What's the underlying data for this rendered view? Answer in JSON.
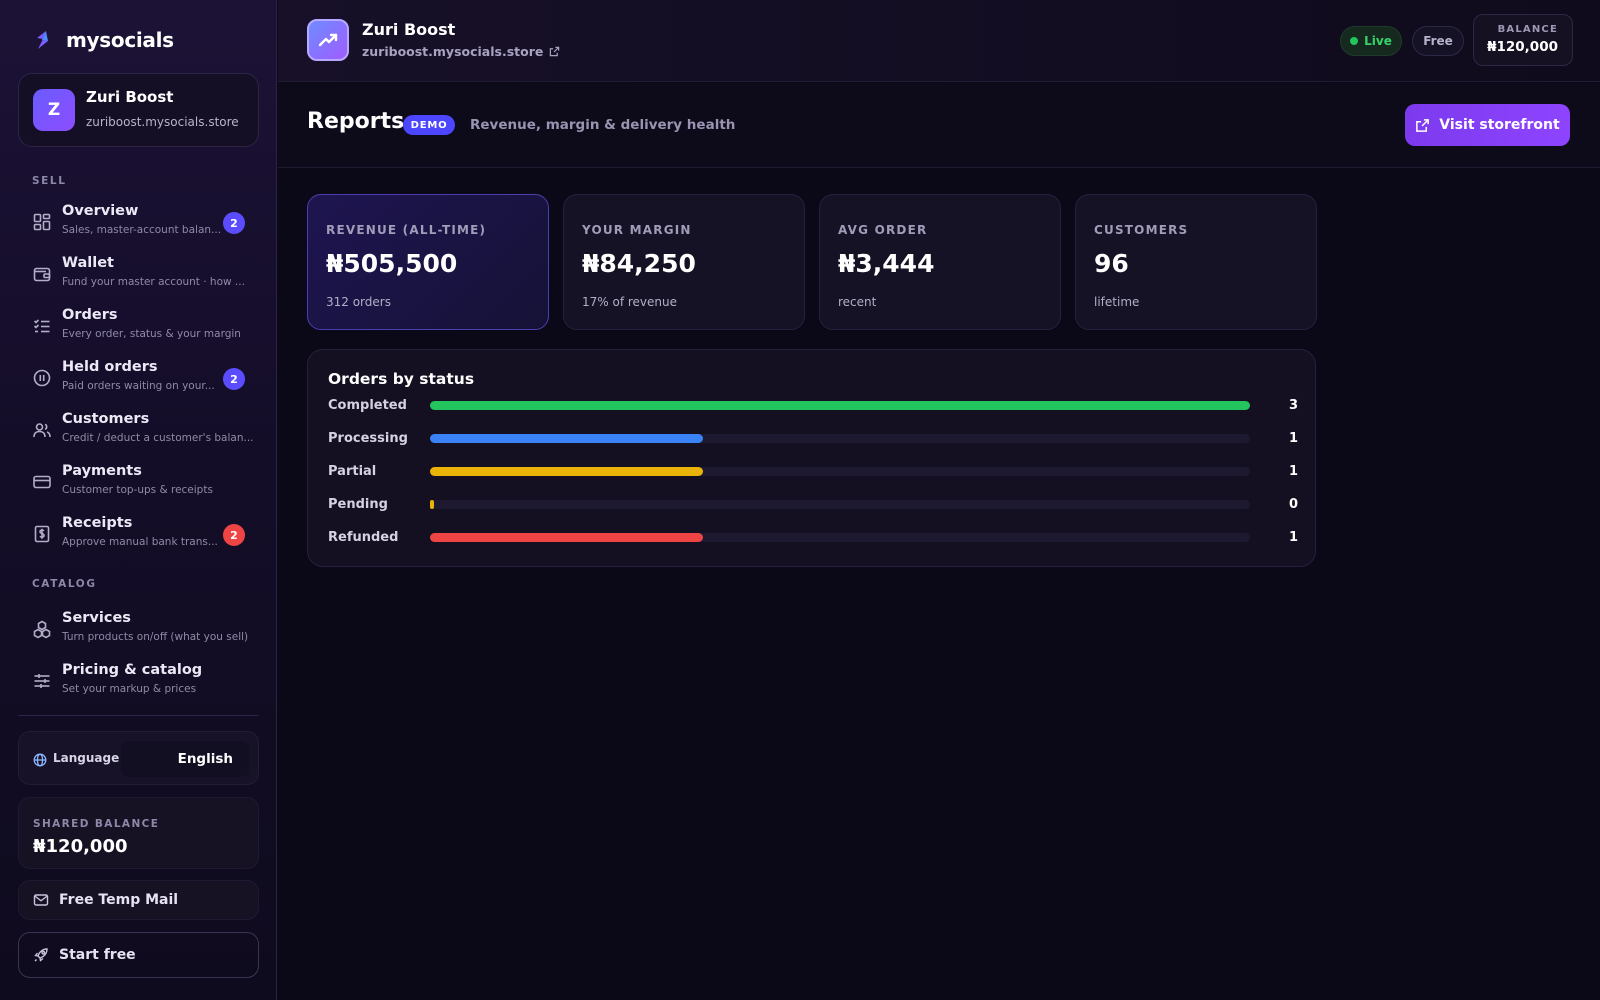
{
  "sidebar": {
    "brand": "mysocials",
    "store": {
      "initial": "Z",
      "name": "Zuri Boost",
      "url": "zuriboost.mysocials.store"
    },
    "sections": {
      "sell": "SELL",
      "catalog": "CATALOG"
    },
    "items": [
      {
        "title": "Overview",
        "subtitle": "Sales, master-account balan...",
        "icon": "grid-icon",
        "badge": "2",
        "badge_color": "#5b4dff"
      },
      {
        "title": "Wallet",
        "subtitle": "Fund your master account · how ...",
        "icon": "wallet-icon"
      },
      {
        "title": "Orders",
        "subtitle": "Every order, status & your margin",
        "icon": "checklist-icon"
      },
      {
        "title": "Held orders",
        "subtitle": "Paid orders waiting on your...",
        "icon": "pause-circle-icon",
        "badge": "2",
        "badge_color": "#5b4dff"
      },
      {
        "title": "Customers",
        "subtitle": "Credit / deduct a customer's balan...",
        "icon": "users-icon"
      },
      {
        "title": "Payments",
        "subtitle": "Customer top-ups & receipts",
        "icon": "card-icon"
      },
      {
        "title": "Receipts",
        "subtitle": "Approve manual bank trans...",
        "icon": "receipt-icon",
        "badge": "2",
        "badge_color": "#ef4444"
      },
      {
        "title": "Services",
        "subtitle": "Turn products on/off (what you sell)",
        "icon": "boxes-icon"
      },
      {
        "title": "Pricing & catalog",
        "subtitle": "Set your markup & prices",
        "icon": "sliders-icon"
      }
    ],
    "language": {
      "label": "Language",
      "value": "English"
    },
    "shared_balance": {
      "label": "SHARED BALANCE",
      "value": "₦120,000"
    },
    "temp_mail": "Free Temp Mail",
    "start_free": "Start free"
  },
  "topbar": {
    "title": "Zuri Boost",
    "url": "zuriboost.mysocials.store",
    "live": "Live",
    "plan": "Free",
    "balance_label": "BALANCE",
    "balance_value": "₦120,000"
  },
  "page": {
    "title": "Reports",
    "badge": "DEMO",
    "subtitle": "Revenue, margin & delivery health",
    "visit_button": "Visit storefront"
  },
  "stats": [
    {
      "label": "REVENUE (ALL-TIME)",
      "value": "₦505,500",
      "sub": "312 orders"
    },
    {
      "label": "YOUR MARGIN",
      "value": "₦84,250",
      "sub": "17% of revenue"
    },
    {
      "label": "AVG ORDER",
      "value": "₦3,444",
      "sub": "recent"
    },
    {
      "label": "CUSTOMERS",
      "value": "96",
      "sub": "lifetime"
    }
  ],
  "status_panel": {
    "title": "Orders by status",
    "max": 3,
    "rows": [
      {
        "label": "Completed",
        "count": 3,
        "color": "#22c55e"
      },
      {
        "label": "Processing",
        "count": 1,
        "color": "#3b82f6"
      },
      {
        "label": "Partial",
        "count": 1,
        "color": "#eab308"
      },
      {
        "label": "Pending",
        "count": 0,
        "color": "#eab308"
      },
      {
        "label": "Refunded",
        "count": 1,
        "color": "#ef4444"
      }
    ]
  }
}
